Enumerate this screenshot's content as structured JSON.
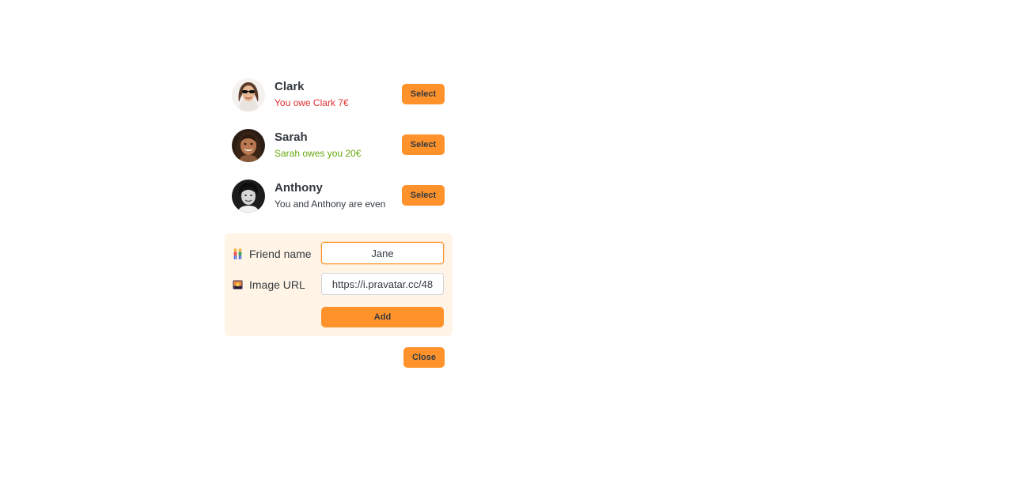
{
  "friends": [
    {
      "name": "Clark",
      "status": "You owe Clark 7€",
      "status_kind": "owe",
      "select_label": "Select",
      "avatar_icon": "woman-with-sunglasses-avatar"
    },
    {
      "name": "Sarah",
      "status": "Sarah owes you 20€",
      "status_kind": "owed",
      "select_label": "Select",
      "avatar_icon": "smiling-woman-avatar"
    },
    {
      "name": "Anthony",
      "status": "You and Anthony are even",
      "status_kind": "even",
      "select_label": "Select",
      "avatar_icon": "man-black-white-avatar"
    }
  ],
  "add_form": {
    "name_icon": "people-emoji-icon",
    "name_label": "Friend name",
    "name_value": "Jane",
    "image_icon": "picture-emoji-icon",
    "image_label": "Image URL",
    "image_value": "https://i.pravatar.cc/48",
    "add_label": "Add"
  },
  "close_label": "Close",
  "colors": {
    "accent": "#ff922b",
    "form_background": "#fff4e6",
    "owe": "#e03131",
    "owed": "#66a80f",
    "text": "#343a40"
  }
}
